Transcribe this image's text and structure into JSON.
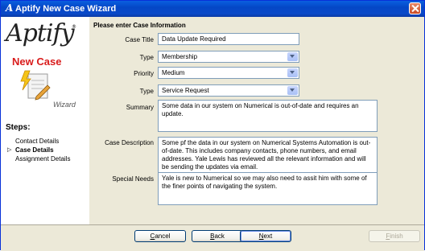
{
  "window": {
    "title": "Aptify New Case Wizard",
    "title_logo": "A"
  },
  "sidebar": {
    "logo": "Aptify",
    "logo_mark": "®",
    "product": "New Case",
    "wizard_label": "Wizard",
    "steps_heading": "Steps:",
    "steps": [
      {
        "label": "Contact Details",
        "active": false
      },
      {
        "label": "Case Details",
        "active": true
      },
      {
        "label": "Assignment Details",
        "active": false
      }
    ],
    "active_marker": "▷"
  },
  "form": {
    "heading": "Please enter Case Information",
    "case_title": {
      "label": "Case Title",
      "value": "Data Update Required"
    },
    "type1": {
      "label": "Type",
      "value": "Membership"
    },
    "priority": {
      "label": "Priority",
      "value": "Medium"
    },
    "type2": {
      "label": "Type",
      "value": "Service Request"
    },
    "summary": {
      "label": "Summary",
      "value": "Some data in our system on Numerical is out-of-date and requires an update."
    },
    "case_description": {
      "label": "Case Description",
      "value": "Some pf the data in our system on Numerical Systems Automation is out-of-date. This includes company contacts, phone numbers, and email addresses. Yale Lewis has reviewed all the relevant information and will be sending the updates via email."
    },
    "special_needs": {
      "label": "Special Needs",
      "value": "Yale is new to Numerical so we may also need to assit him with some of the finer points of navigating the system."
    }
  },
  "buttons": {
    "cancel": {
      "mnemonic": "C",
      "rest": "ancel"
    },
    "back": {
      "mnemonic": "B",
      "rest": "ack"
    },
    "next": {
      "mnemonic": "N",
      "rest": "ext"
    },
    "finish": {
      "mnemonic": "F",
      "rest": "inish"
    }
  }
}
